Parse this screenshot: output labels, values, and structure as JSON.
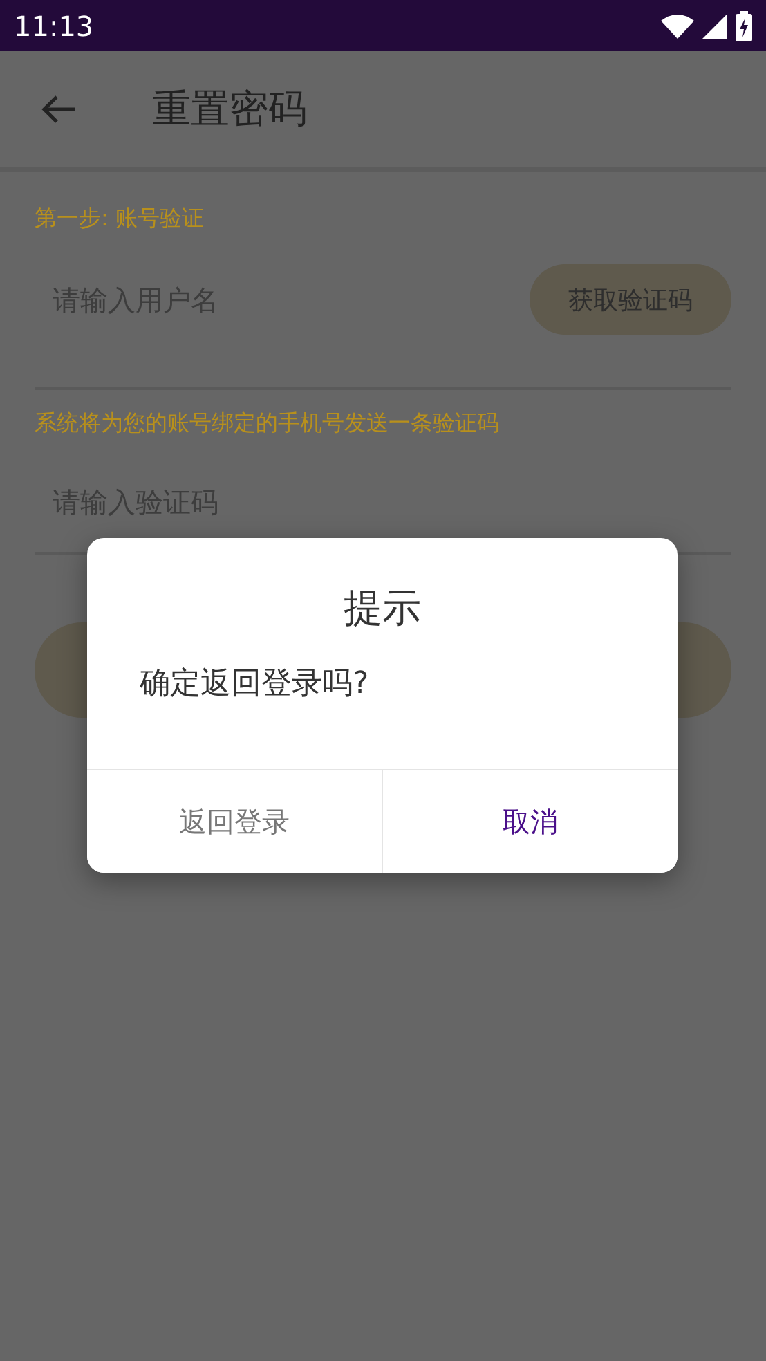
{
  "status_bar": {
    "time": "11:13"
  },
  "app_bar": {
    "title": "重置密码"
  },
  "form": {
    "step_label": "第一步: 账号验证",
    "username": {
      "placeholder": "请输入用户名"
    },
    "get_code_button": "获取验证码",
    "sms_hint": "系统将为您的账号绑定的手机号发送一条验证码",
    "code": {
      "placeholder": "请输入验证码"
    }
  },
  "dialog": {
    "title": "提示",
    "message": "确定返回登录吗?",
    "buttons": [
      {
        "label": "返回登录",
        "kind": "neutral"
      },
      {
        "label": "取消",
        "kind": "primary"
      }
    ]
  }
}
